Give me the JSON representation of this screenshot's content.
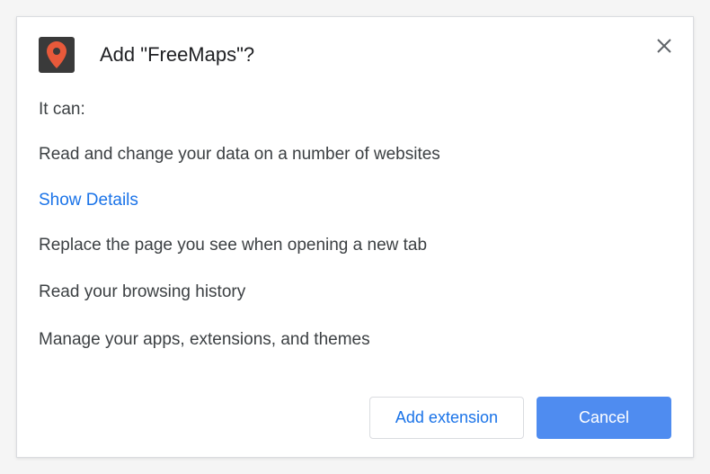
{
  "dialog": {
    "title": "Add \"FreeMaps\"?",
    "intro": "It can:",
    "permissions": {
      "p1": "Read and change your data on a number of websites",
      "p2": "Replace the page you see when opening a new tab",
      "p3": "Read your browsing history",
      "p4": "Manage your apps, extensions, and themes"
    },
    "show_details": "Show Details",
    "buttons": {
      "add": "Add extension",
      "cancel": "Cancel"
    }
  }
}
